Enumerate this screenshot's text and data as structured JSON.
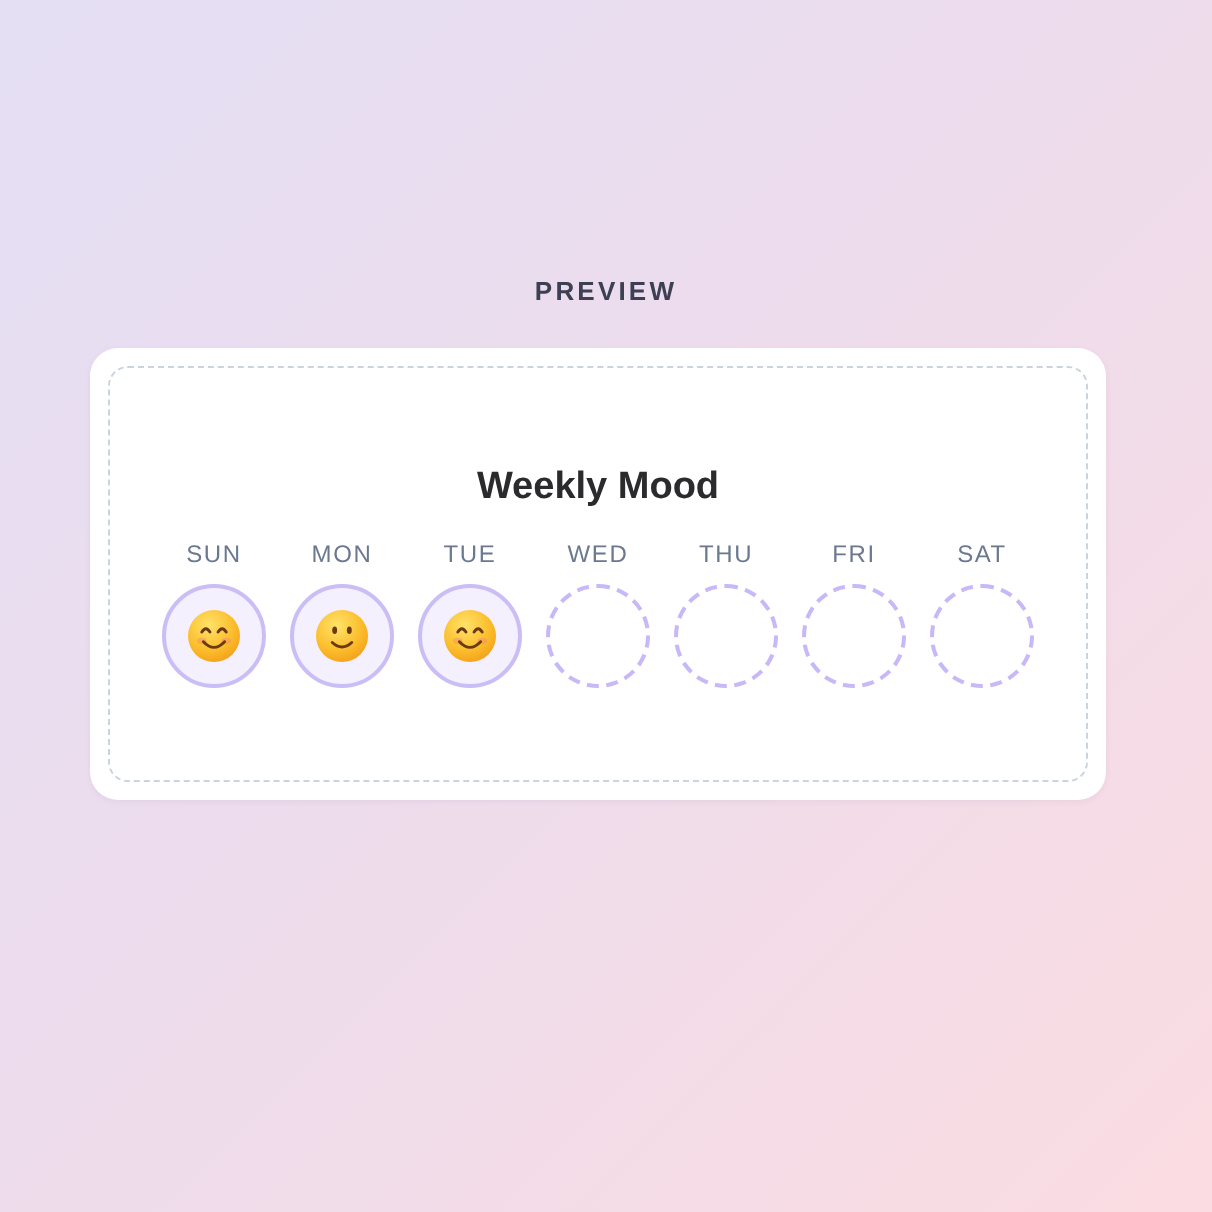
{
  "section_label": "PREVIEW",
  "widget": {
    "title": "Weekly Mood",
    "days": [
      {
        "label": "SUN",
        "kind": "beaming"
      },
      {
        "label": "MON",
        "kind": "smiling"
      },
      {
        "label": "TUE",
        "kind": "beaming"
      },
      {
        "label": "WED",
        "kind": "empty"
      },
      {
        "label": "THU",
        "kind": "empty"
      },
      {
        "label": "FRI",
        "kind": "empty"
      },
      {
        "label": "SAT",
        "kind": "empty"
      }
    ]
  }
}
